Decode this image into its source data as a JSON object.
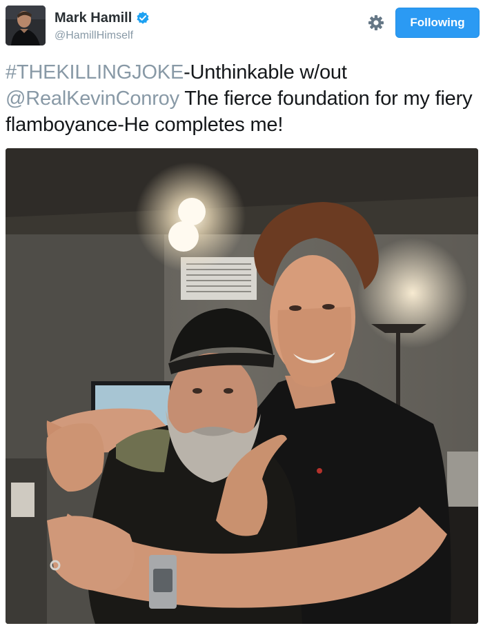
{
  "author": {
    "display_name": "Mark Hamill",
    "handle": "@HamillHimself",
    "verified": true
  },
  "follow_button": {
    "label": "Following",
    "color": "#2b9af3"
  },
  "settings": {
    "icon": "gear-icon"
  },
  "tweet": {
    "hashtag": "#THEKILLINGJOKE",
    "text_after_hashtag": "-Unthinkable w/out",
    "mention": "@RealKevinConroy",
    "text_after_mention": " The fierce foundation for my fiery flamboyance-He completes me!",
    "link_color": "#8899a6"
  },
  "media": {
    "type": "photo"
  }
}
